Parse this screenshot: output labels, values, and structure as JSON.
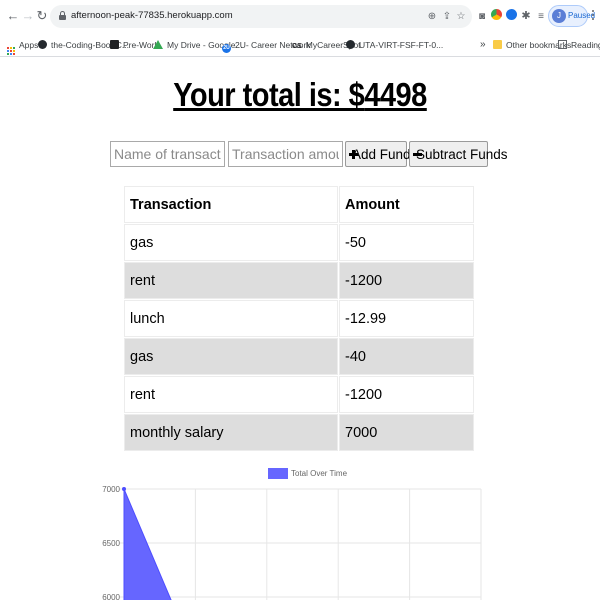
{
  "browser": {
    "url": "afternoon-peak-77835.herokuapp.com",
    "profile_status": "Paused",
    "profile_initial": "J",
    "bookmarks": [
      {
        "label": "Apps",
        "icon": "apps-grid-icon"
      },
      {
        "label": "the-Coding-Boot-C...",
        "icon": "github-icon"
      },
      {
        "label": "Pre-Work",
        "icon": "document-icon"
      },
      {
        "label": "My Drive - Google...",
        "icon": "google-drive-icon"
      },
      {
        "label": "2U- Career Network",
        "icon": "2u-icon"
      },
      {
        "label": "MyCareerSpot",
        "icon": "cs-icon"
      },
      {
        "label": "UTA-VIRT-FSF-FT-0...",
        "icon": "github-icon"
      }
    ],
    "overflow": "»",
    "other_bookmarks": "Other bookmarks",
    "reading_list": "Reading list"
  },
  "page": {
    "total_label": "Your total is: $",
    "total_amount": "4498"
  },
  "form": {
    "name_placeholder": "Name of transaction",
    "amount_placeholder": "Transaction amount",
    "add_label": "Add Funds",
    "subtract_label": "Subtract Funds"
  },
  "table": {
    "headers": [
      "Transaction",
      "Amount"
    ],
    "rows": [
      {
        "name": "gas",
        "amount": "-50"
      },
      {
        "name": "rent",
        "amount": "-1200"
      },
      {
        "name": "lunch",
        "amount": "-12.99"
      },
      {
        "name": "gas",
        "amount": "-40"
      },
      {
        "name": "rent",
        "amount": "-1200"
      },
      {
        "name": "monthly salary",
        "amount": "7000"
      }
    ]
  },
  "chart_data": {
    "type": "area",
    "series": [
      {
        "name": "Total Over Time",
        "values": [
          7000,
          5800
        ],
        "color": "#6666ff"
      }
    ],
    "y_ticks": [
      7000,
      6500,
      6000
    ],
    "ylim": [
      6000,
      7000
    ],
    "grid": true,
    "legend": "top"
  }
}
